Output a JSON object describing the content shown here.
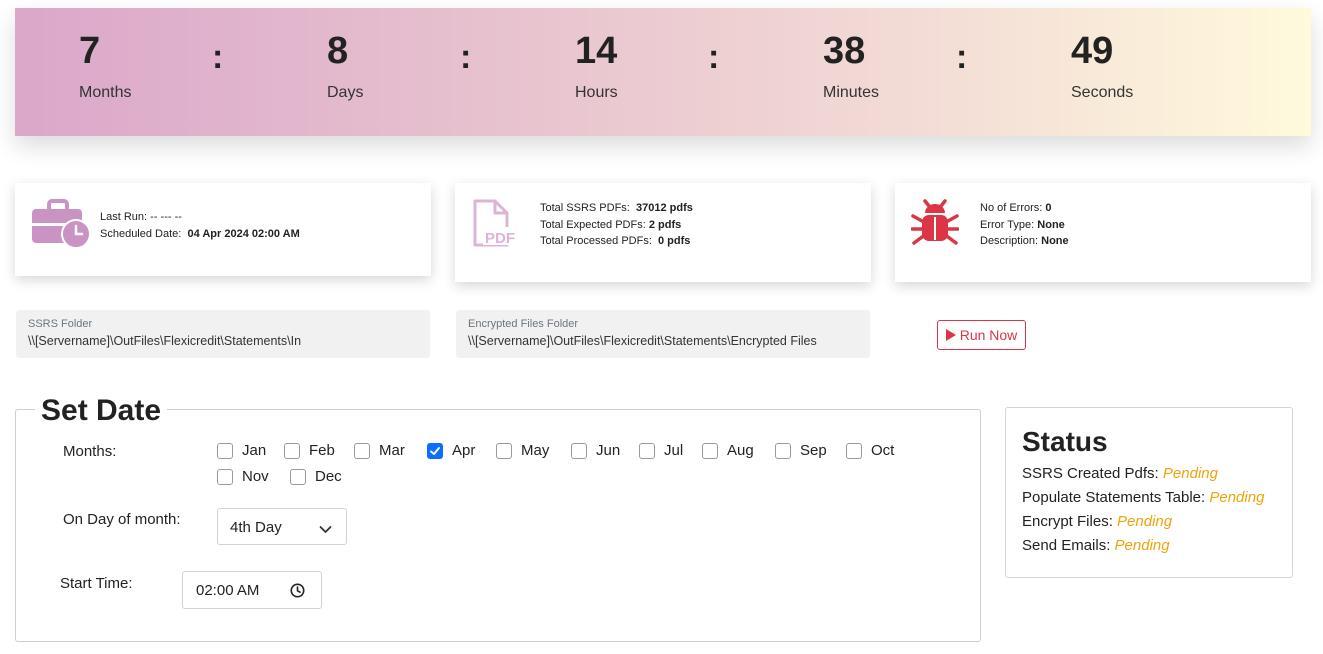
{
  "countdown": {
    "months": {
      "value": "7",
      "label": "Months"
    },
    "days": {
      "value": "8",
      "label": "Days"
    },
    "hours": {
      "value": "14",
      "label": "Hours"
    },
    "minutes": {
      "value": "38",
      "label": "Minutes"
    },
    "seconds": {
      "value": "49",
      "label": "Seconds"
    },
    "separator": ":"
  },
  "schedule_card": {
    "icon": "briefcase-clock-icon",
    "last_run_label": "Last Run:",
    "last_run_value": "-- --- --",
    "scheduled_label": "Scheduled Date:",
    "scheduled_value": "04 Apr 2024 02:00 AM"
  },
  "pdf_card": {
    "icon": "pdf-file-icon",
    "total_ssrs_label": "Total SSRS PDFs:",
    "total_ssrs_value": "37012 pdfs",
    "total_expected_label": "Total Expected PDFs:",
    "total_expected_value": "2 pdfs",
    "total_processed_label": "Total Processed PDFs:",
    "total_processed_value": "0 pdfs",
    "icon_text": "PDF"
  },
  "error_card": {
    "icon": "bug-icon",
    "errors_label": "No of Errors:",
    "errors_value": "0",
    "type_label": "Error Type:",
    "type_value": "None",
    "desc_label": "Description:",
    "desc_value": "None"
  },
  "folders": {
    "ssrs_label": "SSRS Folder",
    "ssrs_value": "\\\\[Servername]\\OutFiles\\Flexicredit\\Statements\\In",
    "encrypted_label": "Encrypted Files Folder",
    "encrypted_value": "\\\\[Servername]\\OutFiles\\Flexicredit\\Statements\\Encrypted Files"
  },
  "run_button": {
    "label": "Run Now",
    "icon": "play-icon"
  },
  "set_date": {
    "title": "Set Date",
    "months_label": "Months:",
    "months": [
      {
        "name": "Jan",
        "checked": false
      },
      {
        "name": "Feb",
        "checked": false
      },
      {
        "name": "Mar",
        "checked": false
      },
      {
        "name": "Apr",
        "checked": true
      },
      {
        "name": "May",
        "checked": false
      },
      {
        "name": "Jun",
        "checked": false
      },
      {
        "name": "Jul",
        "checked": false
      },
      {
        "name": "Aug",
        "checked": false
      },
      {
        "name": "Sep",
        "checked": false
      },
      {
        "name": "Oct",
        "checked": false
      },
      {
        "name": "Nov",
        "checked": false
      },
      {
        "name": "Dec",
        "checked": false
      }
    ],
    "day_label": "On Day of month:",
    "day_value": "4th Day",
    "time_label": "Start Time:",
    "time_value": "02:00 AM"
  },
  "status": {
    "title": "Status",
    "items": [
      {
        "label": "SSRS Created Pdfs:",
        "value": "Pending"
      },
      {
        "label": "Populate Statements Table:",
        "value": "Pending"
      },
      {
        "label": "Encrypt Files:",
        "value": "Pending"
      },
      {
        "label": "Send Emails:",
        "value": "Pending"
      }
    ],
    "pending_color": "#f0a30a"
  },
  "colors": {
    "accent_purple": "#c993c4",
    "error_red": "#dc3545",
    "checkbox_blue": "#0d6efd"
  }
}
